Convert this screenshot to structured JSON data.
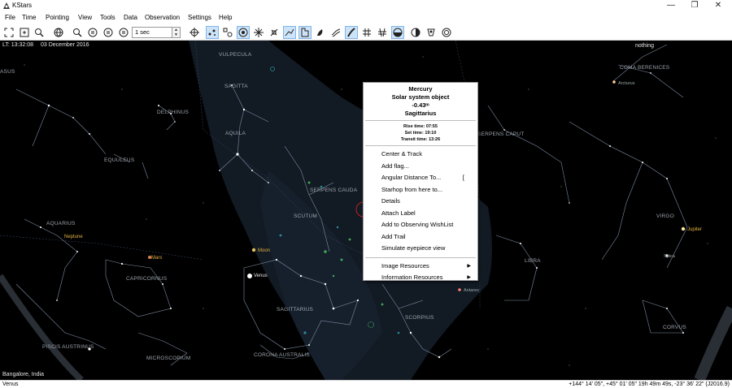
{
  "window": {
    "title": "KStars"
  },
  "menubar": [
    "File",
    "Time",
    "Pointing",
    "View",
    "Tools",
    "Data",
    "Observation",
    "Settings",
    "Help"
  ],
  "toolbar": {
    "time_step": "1 sec"
  },
  "skymap": {
    "local_time": "LT: 13:32:08",
    "date": "03 December 2016",
    "focus_info": "nothing",
    "location": "Bangalore, India",
    "constellations": {
      "vulpecula": "VULPECULA",
      "sagitta": "SAGITTA",
      "aquila": "AQUILA",
      "delphinus": "DELPHINUS",
      "equuleus": "EQUULEUS",
      "aquarius": "AQUARIUS",
      "capricornus": "CAPRICORNUS",
      "piscis_austrinus": "PISCIS AUSTRINUS",
      "microscopium": "MICROSCOPIUM",
      "corona_australis": "CORONA AUSTRALIS",
      "sagittarius": "SAGITTARIUS",
      "scutum": "SCUTUM",
      "serpens_cauda": "SERPENS CAUDA",
      "serpens_caput": "SERPENS CAPUT",
      "scorpius": "SCORPIUS",
      "libra": "LIBRA",
      "virgo": "VIRGO",
      "corvus": "CORVUS",
      "coma_berenices": "COMA BERENICES",
      "pegasus_partial": "ASUS"
    },
    "planets": {
      "neptune": "Neptune",
      "mars": "Mars",
      "moon": "Moon",
      "venus": "Venus",
      "jupiter": "Jupiter",
      "spica": "Spica",
      "arcturus": "Arcturus",
      "antares": "Antares",
      "mercury": "Mercury"
    }
  },
  "popup": {
    "object_name": "Mercury",
    "object_type": "Solar system object",
    "magnitude": "-0.43ᵐ",
    "constellation": "Sagittarius",
    "rise_time": "Rise time: 07:55",
    "set_time": "Set time: 19:10",
    "transit_time": "Transit time: 13:26",
    "items": [
      "Center & Track",
      "Add flag...",
      "Angular Distance To...",
      "Starhop from here to...",
      "Details",
      "Attach Label",
      "Add to Observing WishList",
      "Add Trail",
      "Simulate eyepiece view"
    ],
    "angular_shortcut": "[",
    "resources": [
      "Image Resources",
      "Information Resources"
    ]
  },
  "statusbar": {
    "object": "Venus",
    "coordinates": "+144° 14' 05\", +45° 01' 05\" 19h 49m 49s, -23° 36' 22\" (J2016.9)"
  }
}
